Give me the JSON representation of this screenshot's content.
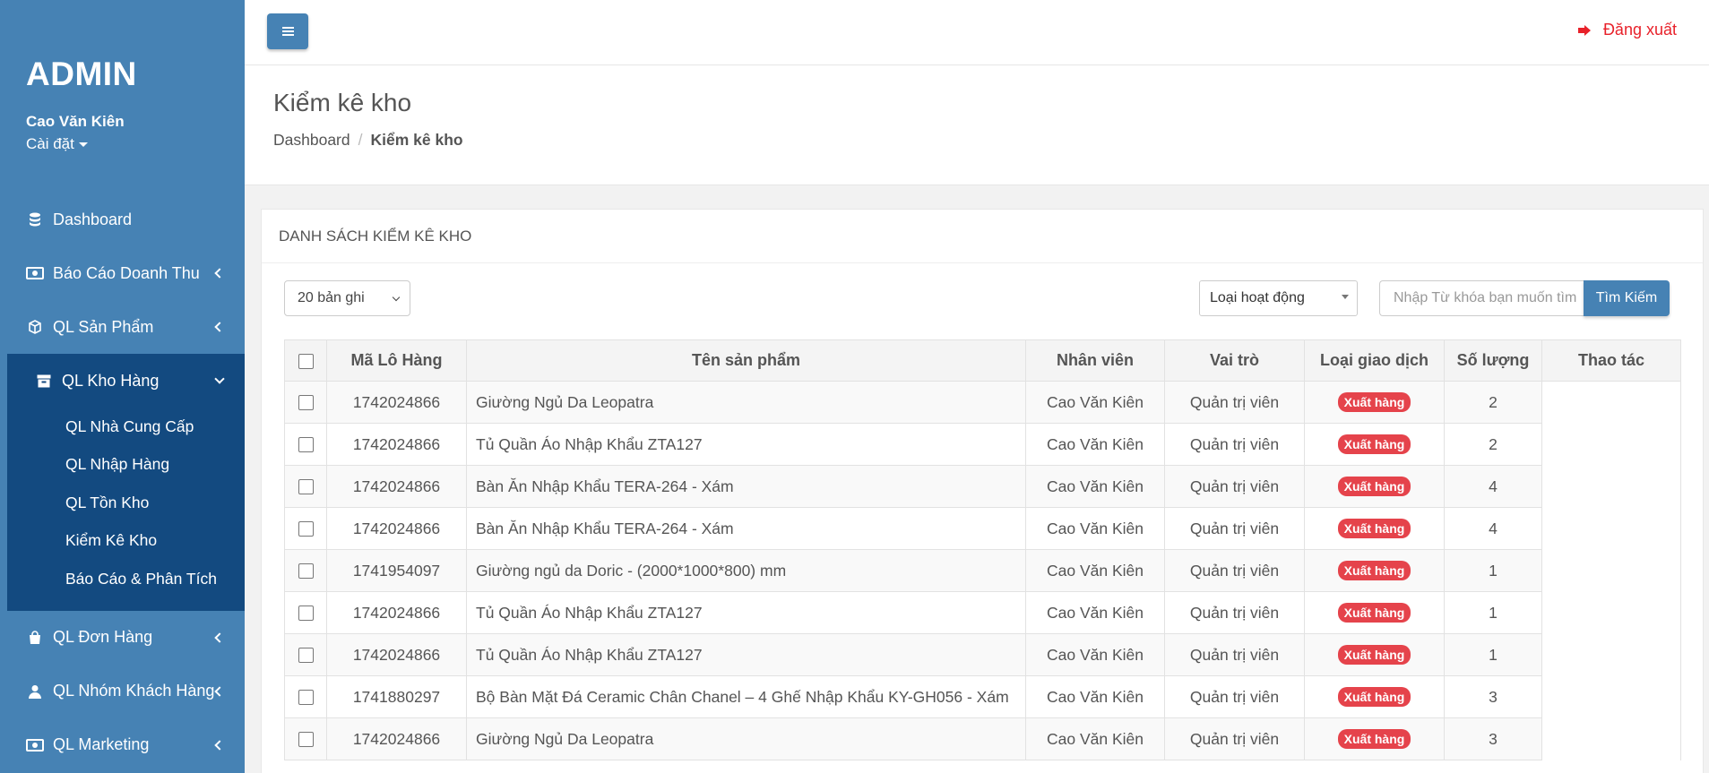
{
  "sidebar": {
    "brand": "ADMIN",
    "user_name": "Cao Văn Kiên",
    "settings_label": "Cài đặt",
    "items": [
      {
        "label": "Dashboard",
        "icon": "database-icon"
      },
      {
        "label": "Báo Cáo Doanh Thu",
        "icon": "money-icon"
      },
      {
        "label": "QL Sản Phẩm",
        "icon": "cube-icon"
      },
      {
        "label": "QL Kho Hàng",
        "icon": "archive-icon",
        "expanded": true
      },
      {
        "label": "QL Đơn Hàng",
        "icon": "shopping-bag-icon"
      },
      {
        "label": "QL Nhóm Khách Hàng",
        "icon": "user-icon"
      },
      {
        "label": "QL Marketing",
        "icon": "money-icon"
      }
    ],
    "submenu": [
      {
        "label": "QL Nhà Cung Cấp"
      },
      {
        "label": "QL Nhập Hàng"
      },
      {
        "label": "QL Tồn Kho"
      },
      {
        "label": "Kiểm Kê Kho"
      },
      {
        "label": "Báo Cáo & Phân Tích"
      }
    ]
  },
  "topbar": {
    "logout_label": "Đăng xuất"
  },
  "page": {
    "title": "Kiểm kê kho",
    "breadcrumb": [
      "Dashboard",
      "Kiểm kê kho"
    ]
  },
  "panel": {
    "title": "DANH SÁCH KIỂM KÊ KHO",
    "records_select": "20 bản ghi",
    "type_select": "Loại hoạt động",
    "search_placeholder": "Nhập Từ khóa bạn muốn tìm",
    "search_button": "Tìm Kiếm"
  },
  "table": {
    "headers": [
      "Mã Lô Hàng",
      "Tên sản phẩm",
      "Nhân viên",
      "Vai trò",
      "Loại giao dịch",
      "Số lượng",
      "Thao tác"
    ],
    "rows": [
      {
        "code": "1742024866",
        "product": "Giường Ngủ Da Leopatra",
        "staff": "Cao Văn Kiên",
        "role": "Quản trị viên",
        "type": "Xuất hàng",
        "qty": "2"
      },
      {
        "code": "1742024866",
        "product": "Tủ Quần Áo Nhập Khẩu ZTA127",
        "staff": "Cao Văn Kiên",
        "role": "Quản trị viên",
        "type": "Xuất hàng",
        "qty": "2"
      },
      {
        "code": "1742024866",
        "product": "Bàn Ăn Nhập Khẩu TERA-264 - Xám",
        "staff": "Cao Văn Kiên",
        "role": "Quản trị viên",
        "type": "Xuất hàng",
        "qty": "4"
      },
      {
        "code": "1742024866",
        "product": "Bàn Ăn Nhập Khẩu TERA-264 - Xám",
        "staff": "Cao Văn Kiên",
        "role": "Quản trị viên",
        "type": "Xuất hàng",
        "qty": "4"
      },
      {
        "code": "1741954097",
        "product": "Giường ngủ da Doric - (2000*1000*800) mm",
        "staff": "Cao Văn Kiên",
        "role": "Quản trị viên",
        "type": "Xuất hàng",
        "qty": "1"
      },
      {
        "code": "1742024866",
        "product": "Tủ Quần Áo Nhập Khẩu ZTA127",
        "staff": "Cao Văn Kiên",
        "role": "Quản trị viên",
        "type": "Xuất hàng",
        "qty": "1"
      },
      {
        "code": "1742024866",
        "product": "Tủ Quần Áo Nhập Khẩu ZTA127",
        "staff": "Cao Văn Kiên",
        "role": "Quản trị viên",
        "type": "Xuất hàng",
        "qty": "1"
      },
      {
        "code": "1741880297",
        "product": "Bộ Bàn Mặt Đá Ceramic Chân Chanel – 4 Ghế Nhập Khẩu KY-GH056 - Xám",
        "staff": "Cao Văn Kiên",
        "role": "Quản trị viên",
        "type": "Xuất hàng",
        "qty": "3"
      },
      {
        "code": "1742024866",
        "product": "Giường Ngủ Da Leopatra",
        "staff": "Cao Văn Kiên",
        "role": "Quản trị viên",
        "type": "Xuất hàng",
        "qty": "3"
      }
    ]
  },
  "colors": {
    "sidebar": "#4682b4",
    "sidebar_active": "#134a80",
    "primary": "#4682b4",
    "badge": "#e5434b",
    "logout": "#e8212a"
  }
}
